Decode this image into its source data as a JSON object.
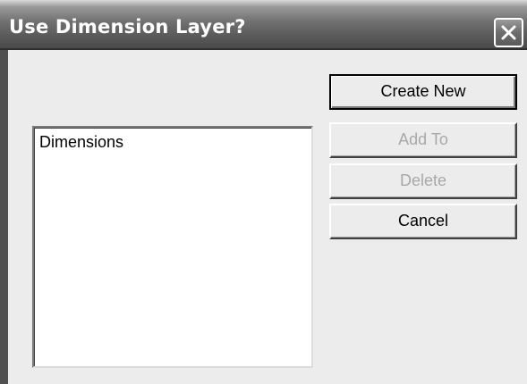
{
  "window": {
    "title": "Use Dimension Layer?",
    "close_icon": "close-icon"
  },
  "layers": {
    "items": [
      "Dimensions"
    ]
  },
  "buttons": {
    "create_new": "Create New",
    "add_to": "Add To",
    "delete": "Delete",
    "cancel": "Cancel"
  },
  "colors": {
    "disabled_text": "#a8a8a8",
    "face": "#ececec",
    "title_text": "#ffffff"
  }
}
